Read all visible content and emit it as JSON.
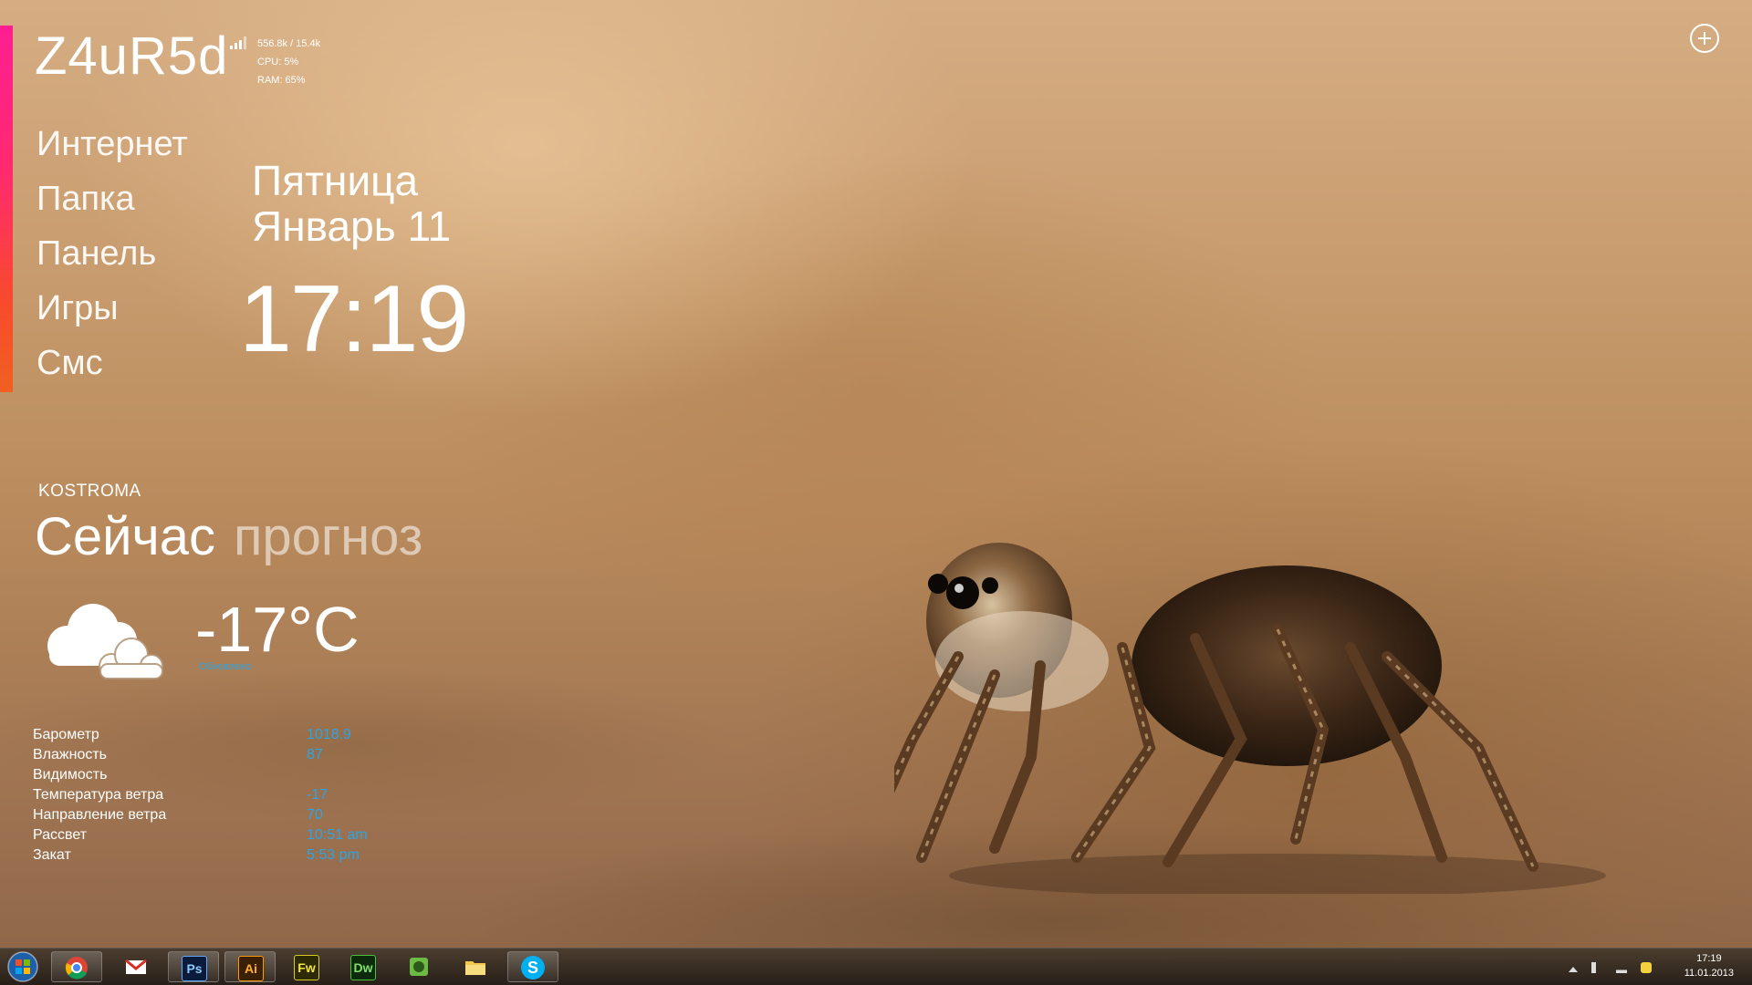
{
  "header": {
    "username": "Z4uR5d",
    "stats": {
      "net": "556.8k / 15.4k",
      "cpu": "CPU: 5%",
      "ram": "RAM: 65%"
    }
  },
  "menu": {
    "items": [
      "Интернет",
      "Папка",
      "Панель",
      "Игры",
      "Смс"
    ]
  },
  "datetime": {
    "day": "Пятница",
    "month_day": "Январь 11",
    "time": "17:19"
  },
  "weather": {
    "city": "KOSTROMA",
    "tab_now": "Сейчас",
    "tab_forecast": "прогноз",
    "temperature": "-17°C",
    "updated": "Обновлено",
    "details": [
      {
        "label": "Барометр",
        "value": "1018.9"
      },
      {
        "label": "Влажность",
        "value": "87"
      },
      {
        "label": "Видимость",
        "value": ""
      },
      {
        "label": "Температура ветра",
        "value": "-17"
      },
      {
        "label": "Направление ветра",
        "value": "70"
      },
      {
        "label": "Рассвет",
        "value": "10:51 am"
      },
      {
        "label": "Закат",
        "value": "5:53 pm"
      }
    ]
  },
  "taskbar": {
    "apps": [
      {
        "name": "chrome",
        "label": ""
      },
      {
        "name": "gmail",
        "label": ""
      },
      {
        "name": "photoshop",
        "label": "Ps"
      },
      {
        "name": "illustrator",
        "label": "Ai"
      },
      {
        "name": "fireworks",
        "label": "Fw"
      },
      {
        "name": "dreamweaver",
        "label": "Dw"
      },
      {
        "name": "evernote",
        "label": ""
      },
      {
        "name": "explorer",
        "label": ""
      },
      {
        "name": "skype",
        "label": "S"
      }
    ],
    "clock_time": "17:19",
    "clock_date": "11.01.2013"
  },
  "colors": {
    "accent_pink": "#ff1e92",
    "accent_orange": "#f06020",
    "weather_value": "#2aa5e6"
  }
}
